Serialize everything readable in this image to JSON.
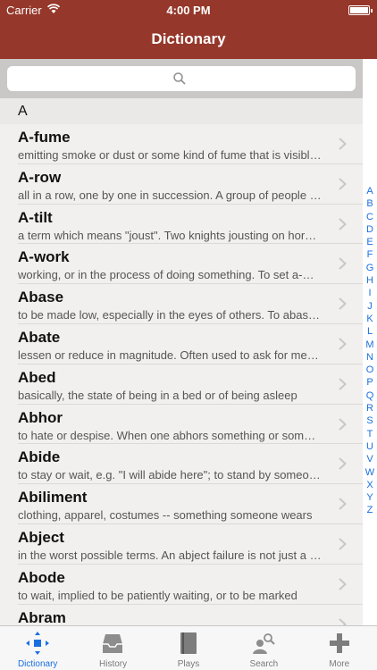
{
  "status": {
    "carrier": "Carrier",
    "time": "4:00 PM"
  },
  "nav": {
    "title": "Dictionary"
  },
  "search": {
    "placeholder": ""
  },
  "list": {
    "section": "A",
    "rows": [
      {
        "word": "A-fume",
        "def": "emitting smoke or dust or some kind of fume that is visible in the air"
      },
      {
        "word": "A-row",
        "def": "all in a row, one by one in succession. A group of people standing"
      },
      {
        "word": "A-tilt",
        "def": "a term which means \"joust\". Two knights jousting on horseback"
      },
      {
        "word": "A-work",
        "def": "working, or in the process of doing something. To set a-work"
      },
      {
        "word": "Abase",
        "def": "to be made low, especially in the eyes of others. To abase oneself"
      },
      {
        "word": "Abate",
        "def": "lessen or reduce in magnitude. Often used to ask for mercy"
      },
      {
        "word": "Abed",
        "def": "basically, the state of being in a bed or of being asleep"
      },
      {
        "word": "Abhor",
        "def": "to hate or despise. When one abhors something or someone"
      },
      {
        "word": "Abide",
        "def": "to stay or wait, e.g. \"I will abide here\"; to stand by someone"
      },
      {
        "word": "Abiliment",
        "def": "clothing, apparel, costumes -- something someone wears"
      },
      {
        "word": "Abject",
        "def": "in the worst possible terms. An abject failure is not just a failure"
      },
      {
        "word": "Abode",
        "def": "to wait, implied to be patiently waiting, or to be marked"
      },
      {
        "word": "Abram",
        "def": ""
      }
    ]
  },
  "index": [
    "A",
    "B",
    "C",
    "D",
    "E",
    "F",
    "G",
    "H",
    "I",
    "J",
    "K",
    "L",
    "M",
    "N",
    "O",
    "P",
    "Q",
    "R",
    "S",
    "T",
    "U",
    "V",
    "W",
    "X",
    "Y",
    "Z"
  ],
  "tabs": [
    {
      "label": "Dictionary",
      "icon": "dictionary-icon",
      "active": true
    },
    {
      "label": "History",
      "icon": "history-tray-icon",
      "active": false
    },
    {
      "label": "Plays",
      "icon": "book-icon",
      "active": false
    },
    {
      "label": "Search",
      "icon": "person-search-icon",
      "active": false
    },
    {
      "label": "More",
      "icon": "plus-icon",
      "active": false
    }
  ],
  "colors": {
    "navbar": "#95372a",
    "accent": "#1a6fe0"
  }
}
